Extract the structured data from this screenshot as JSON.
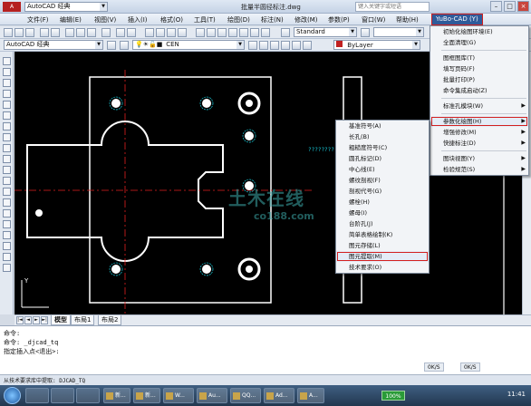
{
  "titlebar": {
    "workspace": "AutoCAD 经典",
    "document_title": "批量半圆径标注.dwg",
    "search_placeholder": "键入关键字或短语"
  },
  "menubar": {
    "items": [
      "文件(F)",
      "编辑(E)",
      "视图(V)",
      "插入(I)",
      "格式(O)",
      "工具(T)",
      "绘图(D)",
      "标注(N)",
      "修改(M)",
      "参数(P)",
      "窗口(W)",
      "帮助(H)"
    ],
    "yubo": "YuBo-CAD (Y)"
  },
  "toolbar1": {
    "workspace": "AutoCAD 经典",
    "textstyle": "Standard"
  },
  "toolbar2": {
    "layer": "CEN",
    "color": "ByLayer"
  },
  "drawing": {
    "dim_text": "????????"
  },
  "yubo_menu": {
    "items": [
      {
        "label": "初始化绘图环境(E)"
      },
      {
        "label": "全面清理(G)"
      },
      {
        "sep": true
      },
      {
        "label": "图框图库(T)"
      },
      {
        "label": "填写页码(F)"
      },
      {
        "label": "批量打印(P)"
      },
      {
        "label": "命令集成启动(Z)"
      },
      {
        "sep": true
      },
      {
        "label": "标准孔模块(W)",
        "submenu": true
      },
      {
        "sep": true
      },
      {
        "label": "参数化绘图(H)",
        "submenu": true,
        "highlight": true
      },
      {
        "label": "增强修改(M)",
        "submenu": true
      },
      {
        "label": "快捷标注(D)",
        "submenu": true
      },
      {
        "sep": true
      },
      {
        "label": "图块视图(Y)",
        "submenu": true
      },
      {
        "label": "检验规范(S)",
        "submenu": true
      }
    ]
  },
  "param_submenu": {
    "items": [
      {
        "label": "基准符号(A)"
      },
      {
        "label": "长孔(B)"
      },
      {
        "label": "粗糙度符号(C)"
      },
      {
        "label": "圆孔标记(D)"
      },
      {
        "label": "中心线(E)"
      },
      {
        "label": "螺纹剖视(F)"
      },
      {
        "label": "剖视代号(G)"
      },
      {
        "label": "螺栓(H)"
      },
      {
        "label": "螺母(I)"
      },
      {
        "label": "台阶孔(J)"
      },
      {
        "label": "简单表格绘制(K)"
      },
      {
        "label": "图元存储(L)"
      },
      {
        "label": "图元提取(M)",
        "highlight": true
      },
      {
        "label": "技术要求(O)"
      }
    ]
  },
  "layout_tabs": [
    "模型",
    "布局1",
    "布局2"
  ],
  "command_lines": [
    "命令:",
    "命令: _djcad_tq",
    "指定插入点<退出>:"
  ],
  "status_small": [
    "0K/S",
    "0K/S"
  ],
  "statusbar_text": "从技术要求库中提取: DJCAD_TQ",
  "taskbar": {
    "tasks": [
      "新...",
      "新...",
      "W...",
      "Au...",
      "QQ...",
      "Ad...",
      "A..."
    ],
    "zoom": "100%",
    "time": "11:41"
  },
  "watermark": {
    "big": "土木在线",
    "small": "co188.com"
  },
  "colors": {
    "canvas": "#000000",
    "geometry": "#ffffff",
    "centerline": "#ff2020",
    "dim": "#18d0e0",
    "highlight": "#d32020"
  }
}
